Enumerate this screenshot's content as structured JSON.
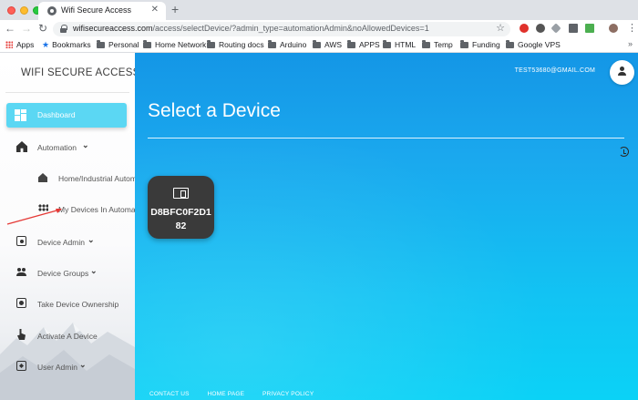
{
  "browser": {
    "tab_title": "Wifi Secure Access",
    "new_tab": "+",
    "url_host": "wifisecureaccess.com",
    "url_rest": "/access/selectDevice/?admin_type=automationAdmin&noAllowedDevices=1",
    "bookmarks": [
      "Apps",
      "Bookmarks",
      "Personal",
      "Home Network",
      "Routing docs",
      "Arduino",
      "AWS",
      "APPS",
      "HTML",
      "Temp",
      "Funding",
      "Google VPS"
    ],
    "bookmarks_more": "»"
  },
  "sidebar": {
    "brand": "WIFI SECURE ACCESS",
    "dashboard_label": "Dashboard",
    "items": [
      {
        "label": "Automation",
        "icon": "home-icon",
        "has_chevron": true
      },
      {
        "label": "Home/Industrial Automation",
        "icon": "home-icon",
        "sub": true
      },
      {
        "label": "My Devices In Automation",
        "icon": "grid-icon",
        "sub": true
      },
      {
        "label": "Device Admin",
        "icon": "admin-icon",
        "has_chevron": true
      },
      {
        "label": "Device Groups",
        "icon": "group-icon",
        "has_chevron": true
      },
      {
        "label": "Take Device Ownership",
        "icon": "ownership-icon"
      },
      {
        "label": "Activate A Device",
        "icon": "touch-icon"
      },
      {
        "label": "User Admin",
        "icon": "user-admin-icon",
        "has_chevron": true
      }
    ]
  },
  "main": {
    "user_email": "TEST53680@GMAIL.COM",
    "page_title": "Select a Device",
    "devices": [
      {
        "id": "D8BFC0F2D182"
      }
    ],
    "footer_links": [
      "CONTACT US",
      "HOME PAGE",
      "PRIVACY POLICY"
    ]
  },
  "colors": {
    "accent": "#5bd7f3",
    "main_bg": "#1aa8ee",
    "card": "#3a3a3a",
    "annotation_arrow": "#e53935"
  }
}
